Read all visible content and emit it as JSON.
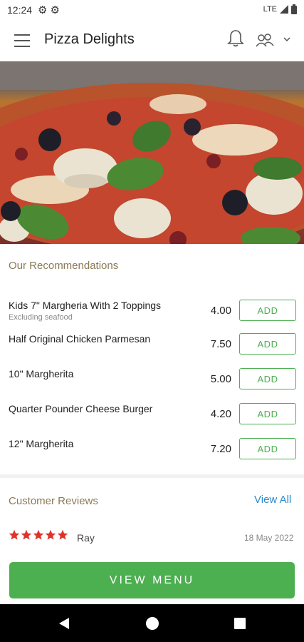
{
  "status_bar": {
    "time": "12:24",
    "network": "LTE"
  },
  "app_bar": {
    "title": "Pizza Delights"
  },
  "hero": {
    "image": "pizza-photo"
  },
  "recommendations": {
    "title": "Our Recommendations",
    "items": [
      {
        "name": "Kids 7\" Margheria With 2 Toppings",
        "subtitle": "Excluding seafood",
        "price": "4.00",
        "add_label": "ADD"
      },
      {
        "name": "Half Original Chicken Parmesan",
        "subtitle": "",
        "price": "7.50",
        "add_label": "ADD"
      },
      {
        "name": "10\" Margherita",
        "subtitle": "",
        "price": "5.00",
        "add_label": "ADD"
      },
      {
        "name": "Quarter Pounder Cheese Burger",
        "subtitle": "",
        "price": "4.20",
        "add_label": "ADD"
      },
      {
        "name": "12\" Margherita",
        "subtitle": "",
        "price": "7.20",
        "add_label": "ADD"
      }
    ]
  },
  "reviews": {
    "title": "Customer Reviews",
    "view_all": "View All",
    "items": [
      {
        "rating": 5,
        "reviewer": "Ray",
        "date": "18 May 2022"
      }
    ]
  },
  "view_menu": {
    "label": "VIEW MENU"
  },
  "colors": {
    "accent": "#4caf50",
    "link": "#2b8ac9",
    "section_title": "#8a7a55",
    "star": "#e0322c"
  }
}
